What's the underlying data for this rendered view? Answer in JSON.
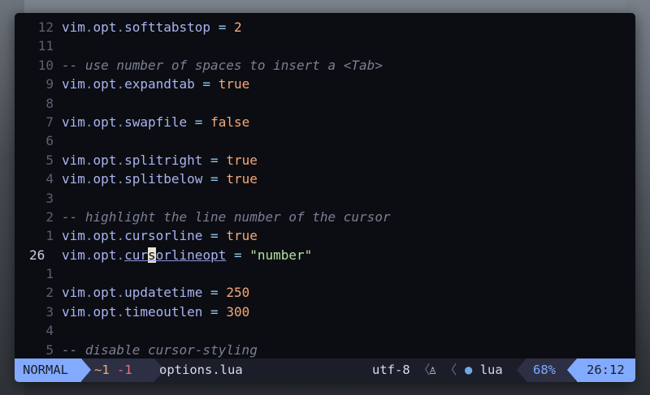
{
  "editor": {
    "lines": [
      {
        "num": "12",
        "code": [
          [
            "ident",
            "vim"
          ],
          [
            "dot",
            "."
          ],
          [
            "ident",
            "opt"
          ],
          [
            "dot",
            "."
          ],
          [
            "ident",
            "softtabstop"
          ],
          [
            "op",
            " = "
          ],
          [
            "num",
            "2"
          ]
        ]
      },
      {
        "num": "11",
        "code": []
      },
      {
        "num": "10",
        "code": [
          [
            "comment",
            "-- use number of spaces to insert a <Tab>"
          ]
        ]
      },
      {
        "num": "9",
        "code": [
          [
            "ident",
            "vim"
          ],
          [
            "dot",
            "."
          ],
          [
            "ident",
            "opt"
          ],
          [
            "dot",
            "."
          ],
          [
            "ident",
            "expandtab"
          ],
          [
            "op",
            " = "
          ],
          [
            "bool",
            "true"
          ]
        ]
      },
      {
        "num": "8",
        "code": []
      },
      {
        "num": "7",
        "code": [
          [
            "ident",
            "vim"
          ],
          [
            "dot",
            "."
          ],
          [
            "ident",
            "opt"
          ],
          [
            "dot",
            "."
          ],
          [
            "ident",
            "swapfile"
          ],
          [
            "op",
            " = "
          ],
          [
            "bool",
            "false"
          ]
        ]
      },
      {
        "num": "6",
        "code": []
      },
      {
        "num": "5",
        "code": [
          [
            "ident",
            "vim"
          ],
          [
            "dot",
            "."
          ],
          [
            "ident",
            "opt"
          ],
          [
            "dot",
            "."
          ],
          [
            "ident",
            "splitright"
          ],
          [
            "op",
            " = "
          ],
          [
            "bool",
            "true"
          ]
        ]
      },
      {
        "num": "4",
        "code": [
          [
            "ident",
            "vim"
          ],
          [
            "dot",
            "."
          ],
          [
            "ident",
            "opt"
          ],
          [
            "dot",
            "."
          ],
          [
            "ident",
            "splitbelow"
          ],
          [
            "op",
            " = "
          ],
          [
            "bool",
            "true"
          ]
        ]
      },
      {
        "num": "3",
        "code": []
      },
      {
        "num": "2",
        "code": [
          [
            "comment",
            "-- highlight the line number of the cursor"
          ]
        ]
      },
      {
        "num": "1",
        "code": [
          [
            "ident",
            "vim"
          ],
          [
            "dot",
            "."
          ],
          [
            "ident",
            "opt"
          ],
          [
            "dot",
            "."
          ],
          [
            "ident",
            "cursorline"
          ],
          [
            "op",
            " = "
          ],
          [
            "bool",
            "true"
          ]
        ]
      },
      {
        "num": "26",
        "current": true,
        "code": [
          [
            "ident",
            "vim"
          ],
          [
            "dot",
            "."
          ],
          [
            "ident",
            "opt"
          ],
          [
            "dot",
            "."
          ],
          [
            "ident-ul",
            "cur"
          ],
          [
            "cursor",
            "s"
          ],
          [
            "ident-ul",
            "orlineopt"
          ],
          [
            "op",
            " = "
          ],
          [
            "str",
            "\"number\""
          ]
        ]
      },
      {
        "num": "1",
        "code": []
      },
      {
        "num": "2",
        "code": [
          [
            "ident",
            "vim"
          ],
          [
            "dot",
            "."
          ],
          [
            "ident",
            "opt"
          ],
          [
            "dot",
            "."
          ],
          [
            "ident",
            "updatetime"
          ],
          [
            "op",
            " = "
          ],
          [
            "num",
            "250"
          ]
        ]
      },
      {
        "num": "3",
        "code": [
          [
            "ident",
            "vim"
          ],
          [
            "dot",
            "."
          ],
          [
            "ident",
            "opt"
          ],
          [
            "dot",
            "."
          ],
          [
            "ident",
            "timeoutlen"
          ],
          [
            "op",
            " = "
          ],
          [
            "num",
            "300"
          ]
        ]
      },
      {
        "num": "4",
        "code": []
      },
      {
        "num": "5",
        "code": [
          [
            "comment",
            "-- disable cursor-styling"
          ]
        ]
      }
    ]
  },
  "statusline": {
    "mode": "NORMAL",
    "diff_added": "~1",
    "diff_removed": "-1",
    "filename": "options.lua",
    "encoding": "utf-8",
    "separator": "〈",
    "os_icon": "♙",
    "filetype_icon": "●",
    "filetype": "lua",
    "percent": "68%",
    "position": "26:12"
  },
  "colors": {
    "accent": "#82aaff",
    "background": "#0b0d12",
    "statusline_bg": "#1b1d28"
  }
}
